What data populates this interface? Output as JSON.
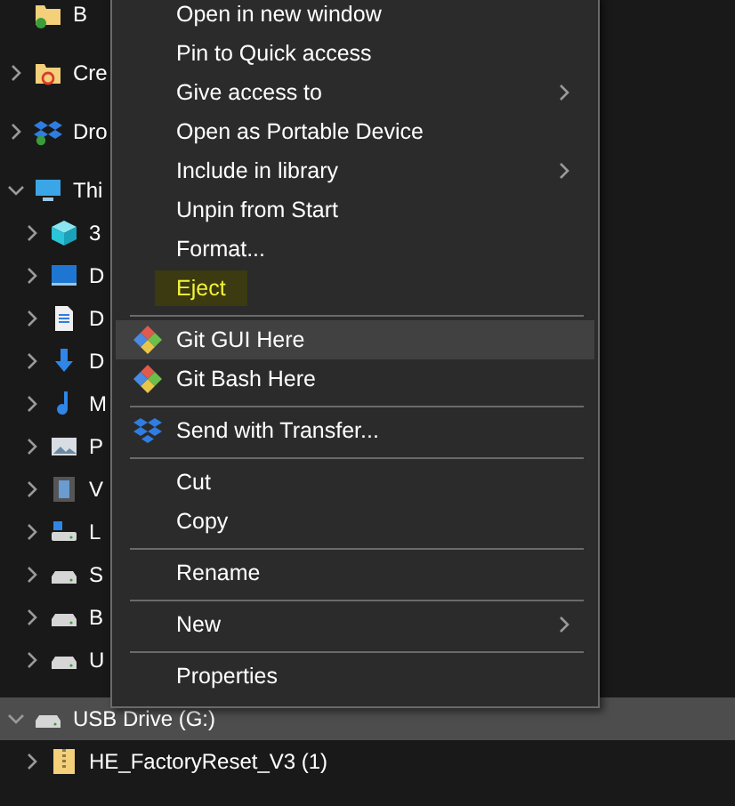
{
  "tree": [
    {
      "label": "B",
      "kind": "synced-folder",
      "selected": false
    },
    {
      "label": "Cre",
      "kind": "cloud-folder",
      "expanded": false,
      "selected": false
    },
    {
      "label": "Dro",
      "kind": "dropbox",
      "expanded": false,
      "selected": false
    },
    {
      "label": "Thi",
      "kind": "computer",
      "expanded": true,
      "selected": false,
      "children": [
        {
          "label": "3",
          "kind": "cube",
          "expanded": false,
          "selected": false
        },
        {
          "label": "D",
          "kind": "desktop",
          "expanded": false,
          "selected": false
        },
        {
          "label": "D",
          "kind": "document",
          "expanded": false,
          "selected": false
        },
        {
          "label": "D",
          "kind": "download",
          "expanded": false,
          "selected": false
        },
        {
          "label": "M",
          "kind": "music",
          "expanded": false,
          "selected": false
        },
        {
          "label": "P",
          "kind": "pictures",
          "expanded": false,
          "selected": false
        },
        {
          "label": "V",
          "kind": "videos",
          "expanded": false,
          "selected": false
        },
        {
          "label": "L",
          "kind": "system-drive",
          "expanded": false,
          "selected": false
        },
        {
          "label": "S",
          "kind": "drive",
          "expanded": false,
          "selected": false
        },
        {
          "label": "B",
          "kind": "drive",
          "expanded": false,
          "selected": false
        },
        {
          "label": "U",
          "kind": "drive",
          "expanded": false,
          "selected": false
        }
      ]
    },
    {
      "label": "USB Drive (G:)",
      "kind": "drive",
      "expanded": true,
      "selected": true,
      "children": [
        {
          "label": "HE_FactoryReset_V3 (1)",
          "kind": "zip-folder",
          "expanded": false,
          "selected": false
        }
      ]
    }
  ],
  "context_menu": {
    "sections": [
      {
        "items": [
          {
            "label": "Open in new window",
            "kind": "plain",
            "submenu": false,
            "selected": false,
            "marked": false
          },
          {
            "label": "Pin to Quick access",
            "kind": "plain",
            "submenu": false,
            "selected": false,
            "marked": false
          },
          {
            "label": "Give access to",
            "kind": "plain",
            "submenu": true,
            "selected": false,
            "marked": false
          },
          {
            "label": "Open as Portable Device",
            "kind": "plain",
            "submenu": false,
            "selected": false,
            "marked": false
          },
          {
            "label": "Include in library",
            "kind": "plain",
            "submenu": true,
            "selected": false,
            "marked": false
          },
          {
            "label": "Unpin from Start",
            "kind": "plain",
            "submenu": false,
            "selected": false,
            "marked": false
          },
          {
            "label": "Format...",
            "kind": "plain",
            "submenu": false,
            "selected": false,
            "marked": false
          },
          {
            "label": "Eject",
            "kind": "plain",
            "submenu": false,
            "selected": false,
            "marked": true
          }
        ]
      },
      {
        "items": [
          {
            "label": "Git GUI Here",
            "kind": "git",
            "submenu": false,
            "selected": true,
            "marked": false
          },
          {
            "label": "Git Bash Here",
            "kind": "git",
            "submenu": false,
            "selected": false,
            "marked": false
          }
        ]
      },
      {
        "items": [
          {
            "label": "Send with Transfer...",
            "kind": "transfer",
            "submenu": false,
            "selected": false,
            "marked": false
          }
        ]
      },
      {
        "items": [
          {
            "label": "Cut",
            "kind": "plain",
            "submenu": false,
            "selected": false,
            "marked": false
          },
          {
            "label": "Copy",
            "kind": "plain",
            "submenu": false,
            "selected": false,
            "marked": false
          }
        ]
      },
      {
        "items": [
          {
            "label": "Rename",
            "kind": "plain",
            "submenu": false,
            "selected": false,
            "marked": false
          }
        ]
      },
      {
        "items": [
          {
            "label": "New",
            "kind": "plain",
            "submenu": true,
            "selected": false,
            "marked": false
          }
        ]
      },
      {
        "items": [
          {
            "label": "Properties",
            "kind": "plain",
            "submenu": false,
            "selected": false,
            "marked": false
          }
        ]
      }
    ]
  }
}
